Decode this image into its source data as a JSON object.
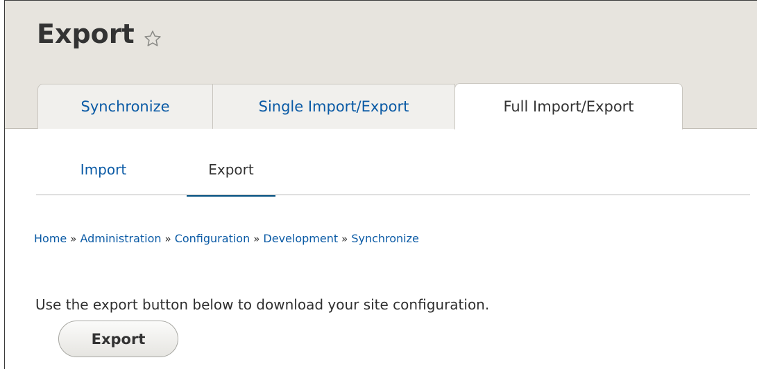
{
  "page": {
    "title": "Export"
  },
  "primary_tabs": [
    {
      "label": "Synchronize",
      "active": false
    },
    {
      "label": "Single Import/Export",
      "active": false
    },
    {
      "label": "Full Import/Export",
      "active": true
    }
  ],
  "secondary_tabs": [
    {
      "label": "Import",
      "active": false
    },
    {
      "label": "Export",
      "active": true
    }
  ],
  "breadcrumb": {
    "items": [
      "Home",
      "Administration",
      "Configuration",
      "Development",
      "Synchronize"
    ],
    "separator": "»"
  },
  "content": {
    "description": "Use the export button below to download your site configuration.",
    "export_button_label": "Export"
  },
  "colors": {
    "link": "#0a5aa5",
    "header_bg": "#e7e4de",
    "active_underline": "#004f80"
  },
  "icons": {
    "favorite": "star-outline-icon"
  }
}
